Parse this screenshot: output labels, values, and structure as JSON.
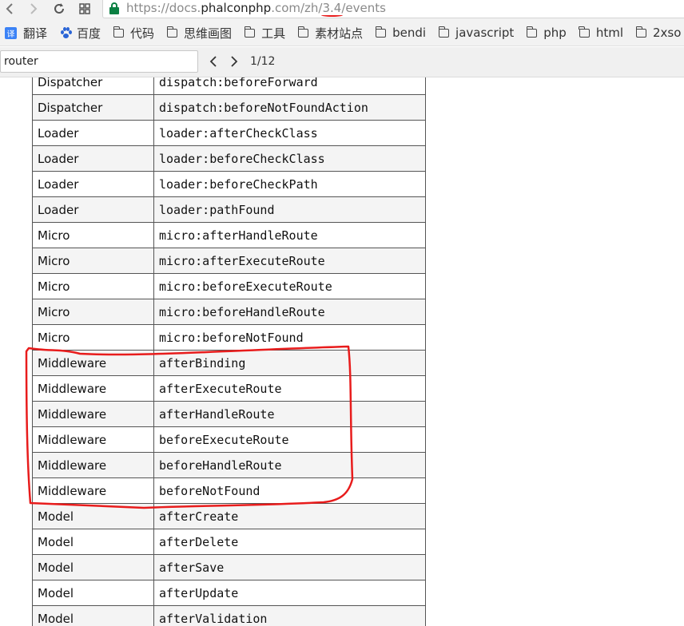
{
  "browser": {
    "url": {
      "scheme": "https://",
      "host_prefix": "docs.",
      "host_main": "phalconphp",
      "host_suffix": ".com",
      "path_lang": "/zh/",
      "path_version": "3.4",
      "path_rest": "/events"
    },
    "icons": [
      "back-icon",
      "forward-icon",
      "reload-icon",
      "apps-icon",
      "lock-icon"
    ]
  },
  "bookmarks": [
    {
      "label": "翻译",
      "icon": "translate-icon"
    },
    {
      "label": "百度",
      "icon": "baidu-icon"
    },
    {
      "label": "代码",
      "icon": "folder-icon"
    },
    {
      "label": "思维画图",
      "icon": "folder-icon"
    },
    {
      "label": "工具",
      "icon": "folder-icon"
    },
    {
      "label": "素材站点",
      "icon": "folder-icon"
    },
    {
      "label": "bendi",
      "icon": "folder-icon"
    },
    {
      "label": "javascript",
      "icon": "folder-icon"
    },
    {
      "label": "php",
      "icon": "folder-icon"
    },
    {
      "label": "html",
      "icon": "folder-icon"
    },
    {
      "label": "2xso",
      "icon": "folder-icon"
    }
  ],
  "find": {
    "query": "router",
    "count": "1/12"
  },
  "table": {
    "rows": [
      {
        "component": "Dispatcher",
        "event": "dispatch:beforeForward"
      },
      {
        "component": "Dispatcher",
        "event": "dispatch:beforeNotFoundAction"
      },
      {
        "component": "Loader",
        "event": "loader:afterCheckClass"
      },
      {
        "component": "Loader",
        "event": "loader:beforeCheckClass"
      },
      {
        "component": "Loader",
        "event": "loader:beforeCheckPath"
      },
      {
        "component": "Loader",
        "event": "loader:pathFound"
      },
      {
        "component": "Micro",
        "event": "micro:afterHandleRoute"
      },
      {
        "component": "Micro",
        "event": "micro:afterExecuteRoute"
      },
      {
        "component": "Micro",
        "event": "micro:beforeExecuteRoute"
      },
      {
        "component": "Micro",
        "event": "micro:beforeHandleRoute"
      },
      {
        "component": "Micro",
        "event": "micro:beforeNotFound"
      },
      {
        "component": "Middleware",
        "event": "afterBinding"
      },
      {
        "component": "Middleware",
        "event": "afterExecuteRoute"
      },
      {
        "component": "Middleware",
        "event": "afterHandleRoute"
      },
      {
        "component": "Middleware",
        "event": "beforeExecuteRoute"
      },
      {
        "component": "Middleware",
        "event": "beforeHandleRoute"
      },
      {
        "component": "Middleware",
        "event": "beforeNotFound"
      },
      {
        "component": "Model",
        "event": "afterCreate"
      },
      {
        "component": "Model",
        "event": "afterDelete"
      },
      {
        "component": "Model",
        "event": "afterSave"
      },
      {
        "component": "Model",
        "event": "afterUpdate"
      },
      {
        "component": "Model",
        "event": "afterValidation"
      }
    ]
  },
  "colors": {
    "annotation": "#e81c1c",
    "lock": "#0b8043",
    "row_alt": "#f4f4f4"
  }
}
